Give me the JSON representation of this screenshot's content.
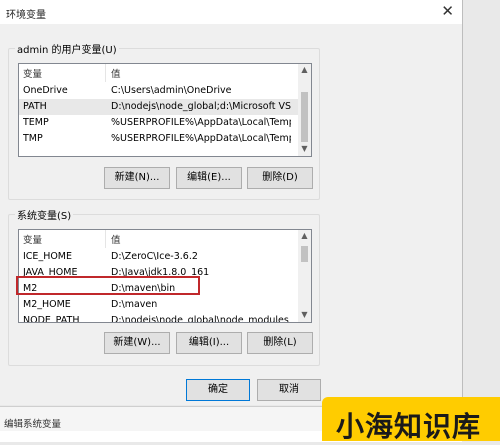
{
  "window": {
    "title": "环境变量",
    "close_glyph": "✕"
  },
  "user_vars": {
    "group_label": "admin 的用户变量(U)",
    "col_variable": "变量",
    "col_value": "值",
    "rows": [
      {
        "name": "OneDrive",
        "value": "C:\\Users\\admin\\OneDrive"
      },
      {
        "name": "PATH",
        "value": "D:\\nodejs\\node_global;d:\\Microsoft VS ..."
      },
      {
        "name": "TEMP",
        "value": "%USERPROFILE%\\AppData\\Local\\Temp"
      },
      {
        "name": "TMP",
        "value": "%USERPROFILE%\\AppData\\Local\\Temp"
      }
    ],
    "new_label": "新建(N)...",
    "edit_label": "编辑(E)...",
    "delete_label": "删除(D)"
  },
  "system_vars": {
    "group_label": "系统变量(S)",
    "col_variable": "变量",
    "col_value": "值",
    "rows": [
      {
        "name": "ICE_HOME",
        "value": "D:\\ZeroC\\Ice-3.6.2"
      },
      {
        "name": "JAVA_HOME",
        "value": "D:\\Java\\jdk1.8.0_161"
      },
      {
        "name": "M2",
        "value": "D:\\maven\\bin"
      },
      {
        "name": "M2_HOME",
        "value": "D:\\maven"
      },
      {
        "name": "NODE_PATH",
        "value": "D:\\nodejs\\node_global\\node_modules"
      }
    ],
    "new_label": "新建(W)...",
    "edit_label": "编辑(I)...",
    "delete_label": "删除(L)"
  },
  "footer": {
    "ok_label": "确定",
    "cancel_label": "取消"
  },
  "edit_window": {
    "title": "编辑系统变量"
  },
  "watermark": {
    "text": "小海知识库",
    "color": "#ffcc00"
  },
  "colors": {
    "highlight": "#c0282b",
    "accent": "#0078d7"
  }
}
